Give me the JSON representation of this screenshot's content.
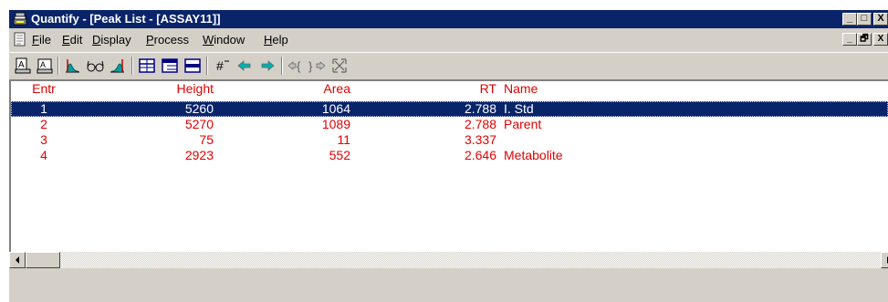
{
  "window": {
    "title": "Quantify - [Peak List - [ASSAY11]]",
    "caption_buttons": [
      "_",
      "□",
      "X"
    ]
  },
  "menu": {
    "items": [
      {
        "label": "File",
        "hotkey": "F"
      },
      {
        "label": "Edit",
        "hotkey": "E"
      },
      {
        "label": "Display",
        "hotkey": "D"
      },
      {
        "label": "Process",
        "hotkey": "P"
      },
      {
        "label": "Window",
        "hotkey": "W"
      },
      {
        "label": "Help",
        "hotkey": "H"
      }
    ],
    "mdi_buttons": [
      "_",
      "🗗",
      "X"
    ]
  },
  "toolbar": {
    "icons": [
      "print-icon",
      "print-preview-icon",
      "peak-left-icon",
      "glasses-icon",
      "peak-right-icon",
      "table-grid-icon",
      "list-view-icon",
      "row-view-icon",
      "hash-icon",
      "arrow-left-icon",
      "arrow-right-icon",
      "expand-icon",
      "collapse-icon",
      "fit-window-icon"
    ]
  },
  "table": {
    "columns": [
      "Entr",
      "Height",
      "Area",
      "RT",
      "Name"
    ],
    "rows": [
      {
        "entr": "1",
        "height": "5260",
        "area": "1064",
        "rt": "2.788",
        "name": "I. Std",
        "selected": true
      },
      {
        "entr": "2",
        "height": "5270",
        "area": "1089",
        "rt": "2.788",
        "name": "Parent",
        "selected": false
      },
      {
        "entr": "3",
        "height": "75",
        "area": "11",
        "rt": "3.337",
        "name": "",
        "selected": false
      },
      {
        "entr": "4",
        "height": "2923",
        "area": "552",
        "rt": "2.646",
        "name": "Metabolite",
        "selected": false
      }
    ]
  },
  "colors": {
    "titlebar": "#0a246a",
    "text_red": "#e00000",
    "selection": "#0a246a",
    "face": "#d4d0c8"
  }
}
